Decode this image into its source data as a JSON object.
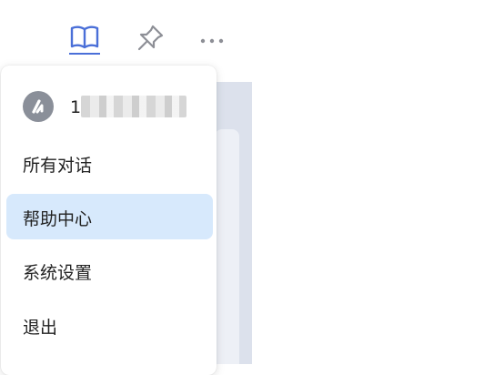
{
  "toolbar": {
    "icons": [
      "book-icon",
      "pin-icon",
      "more-icon"
    ],
    "accent": "#4a6fd8",
    "icon_color": "#8d8f96"
  },
  "menu": {
    "user": {
      "name_visible": "1",
      "name_blurred": true
    },
    "items": [
      {
        "label": "所有对话",
        "active": false
      },
      {
        "label": "帮助中心",
        "active": true
      },
      {
        "label": "系统设置",
        "active": false
      },
      {
        "label": "退出",
        "active": false
      }
    ],
    "active_bg": "#d7e9fc"
  }
}
